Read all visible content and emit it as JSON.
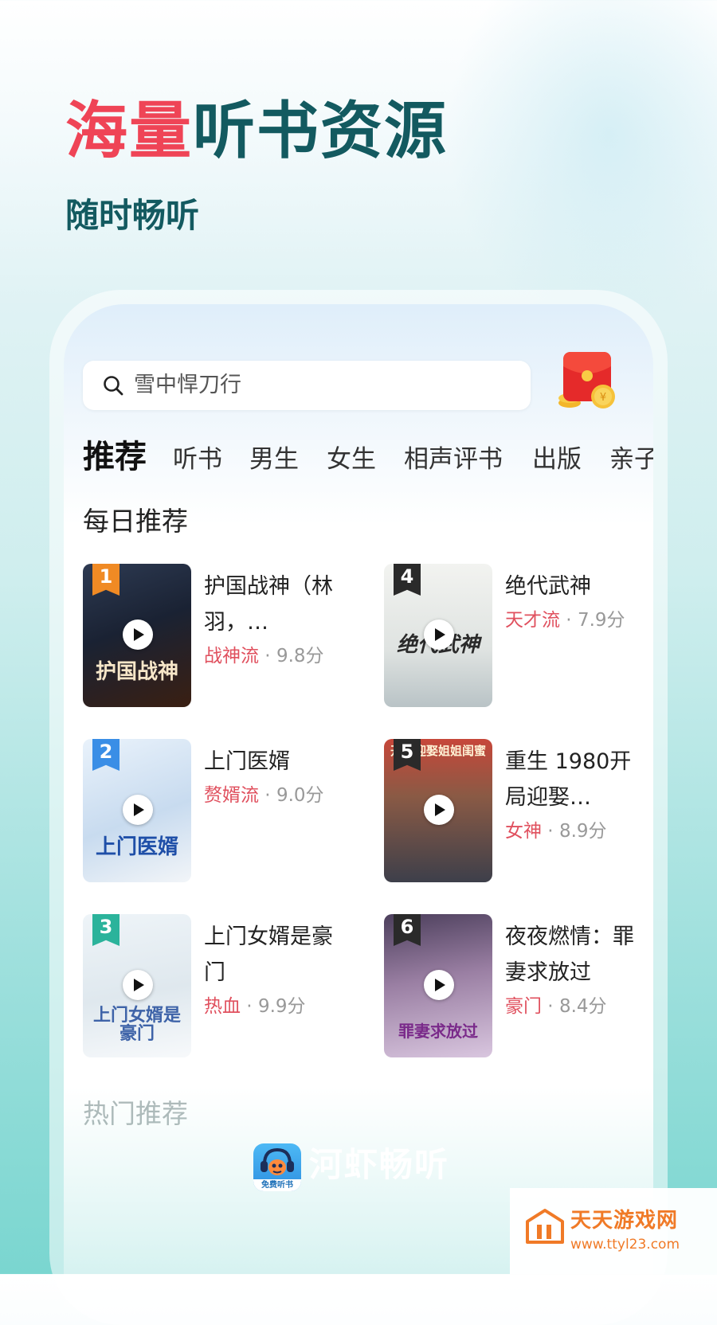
{
  "banner": {
    "headline_highlight": "海量",
    "headline_rest": "听书资源",
    "subheadline": "随时畅听"
  },
  "search": {
    "placeholder": "雪中悍刀行"
  },
  "tabs": [
    "推荐",
    "听书",
    "男生",
    "女生",
    "相声评书",
    "出版",
    "亲子"
  ],
  "daily": {
    "title": "每日推荐",
    "books": [
      {
        "rank": "1",
        "title": "护国战神（林羽，…",
        "tag": "战神流",
        "score": "9.8分",
        "cover_text": "护国战神",
        "badge_color": "#f08a24"
      },
      {
        "rank": "4",
        "title": "绝代武神",
        "tag": "天才流",
        "score": "7.9分",
        "cover_text": "绝代武神",
        "badge_color": "#2a2a2a"
      },
      {
        "rank": "2",
        "title": "上门医婿",
        "tag": "赘婿流",
        "score": "9.0分",
        "cover_text": "上门医婿",
        "badge_color": "#3a8ee6"
      },
      {
        "rank": "5",
        "title": "重生 1980开局迎娶…",
        "tag": "女神",
        "score": "8.9分",
        "cover_text": "开局迎娶姐姐闺蜜",
        "badge_color": "#2a2a2a"
      },
      {
        "rank": "3",
        "title": "上门女婿是豪门",
        "tag": "热血",
        "score": "9.9分",
        "cover_text": "上门女婿是豪门",
        "badge_color": "#2bb39b"
      },
      {
        "rank": "6",
        "title": "夜夜燃情：罪妻求放过",
        "tag": "豪门",
        "score": "8.4分",
        "cover_text": "罪妻求放过",
        "badge_color": "#2a2a2a"
      }
    ]
  },
  "hot": {
    "title": "热门推荐"
  },
  "brand": {
    "name": "河虾畅听",
    "logo_caption": "免费听书"
  },
  "watermark": {
    "name": "天天游戏网",
    "url": "www.ttyl23.com"
  },
  "colors": {
    "accent_red": "#ef4456",
    "teal_text": "#135a60",
    "tag_red": "#e0505e"
  }
}
